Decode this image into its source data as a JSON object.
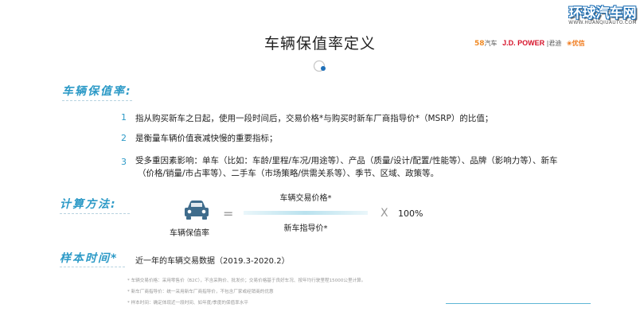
{
  "watermark": {
    "name": "环球汽车网",
    "url": "WWW.HUANQIUAUTO.COM"
  },
  "title": "车辆保值率定义",
  "logos": {
    "brand1_num": "58",
    "brand1_text": "汽车",
    "brand2": "J.D. POWER",
    "brand2_cn": "君迪",
    "brand3": "优信"
  },
  "sections": {
    "definition": "车辆保值率:",
    "formula": "计算方法:",
    "sample": "样本时间*"
  },
  "items": [
    {
      "num": "1",
      "text": "指从购买新车之日起，使用一段时间后，交易价格*与购买时新车厂商指导价*（MSRP）的比值；"
    },
    {
      "num": "2",
      "text": "是衡量车辆价值衰减快慢的重要指标；"
    },
    {
      "num": "3",
      "line1": "受多重因素影响：单车（比如：车龄/里程/车况/用途等）、产品（质量/设计/配置/性能等）、品牌（影响力等）、新车",
      "line2": "（价格/销量/市占率等）、二手车（市场策略/供需关系等）、季节、区域、政策等。"
    }
  ],
  "formula": {
    "left_label": "车辆保值率",
    "equals": "=",
    "numerator": "车辆交易价格*",
    "denominator": "新车指导价*",
    "times": "X",
    "percent": "100%"
  },
  "sample_text": "近一年的车辆交易数据（2019.3-2020.2）",
  "notes": [
    "* 车辆交易价格：采用零售价（B2C），不含采购价、批发价；交易价格基于良好车况、按年均行驶里程15000公里计算。",
    "* 新车厂商指导价：统一采用新车厂商指导价，不包含厂家或经销商的优惠",
    "* 样本时间：确定体现近一段时间、如年度/季度的保值率水平"
  ],
  "colors": {
    "accent": "#2d9ac7",
    "car_icon": "#3f6c8c",
    "brand_jd": "#d6132a",
    "brand_orange": "#f08a24"
  }
}
